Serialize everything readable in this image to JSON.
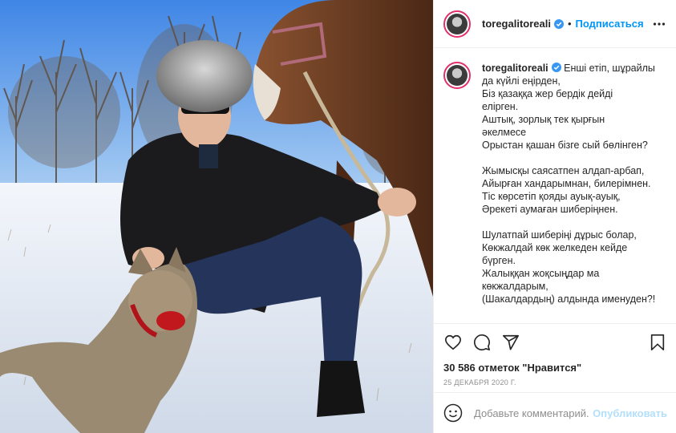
{
  "post": {
    "username": "toregalitoreali",
    "follow_label": "Подписаться",
    "separator": "•",
    "caption_lines": [
      "Енші етіп, шұрайлы",
      "да күйлі еңірден,",
      "Біз қазаққа жер бердік дейді",
      "елірген.",
      "Аштық, зорлық тек қырғын",
      "әкелмесе",
      "Орыстан қашан бізге сый бөлінген?",
      "",
      "Жымысқы саясатпен алдап-арбап,",
      "Айырған хандарымнан, билерімнен.",
      "Тіс көрсетіп қояды ауық-ауық,",
      "Әрекеті аумаған шиберіңнен.",
      "",
      "Шулатпай шиберіңі дұрыс болар,",
      "Көкжалдай көк желкеден кейде",
      "бүрген.",
      "Жалыққан жоқсыңдар ма",
      "көкжалдарым,",
      "(Шакалдардың) алдында именуден?!"
    ],
    "likes": "30 586 отметок \"Нравится\"",
    "date": "25 декабря 2020 г."
  },
  "comment": {
    "placeholder": "Добавьте комментарий...",
    "publish_label": "Опубликовать"
  },
  "colors": {
    "accent": "#0095f6",
    "verified": "#3897f0",
    "publish_disabled": "#b2dffc",
    "avatar_ring": "#e1306c"
  },
  "icons": {
    "verified": "verified-badge-icon",
    "more": "more-options-icon",
    "like": "heart-icon",
    "comment": "comment-bubble-icon",
    "share": "paper-plane-icon",
    "save": "bookmark-icon",
    "emoji": "smiley-icon"
  }
}
